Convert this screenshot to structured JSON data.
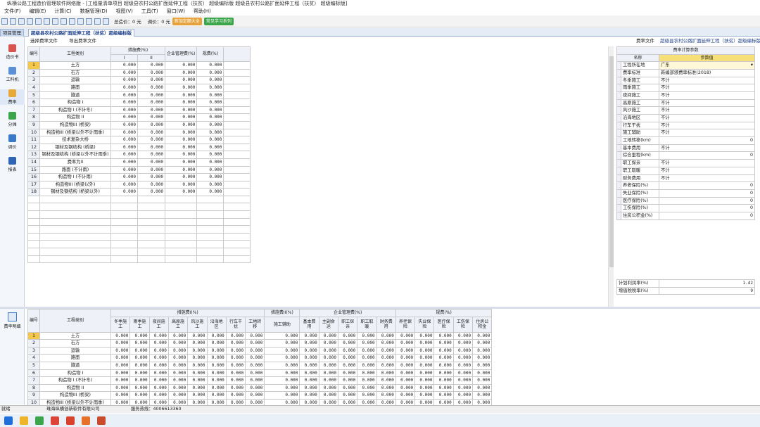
{
  "title": "纵横公路工程造价管理软件网络版 - [工程量清单项目  超级县农村公路扩面延伸工程（扶贫） 超级编标版  超级县农村公路扩面延伸工程（扶贫） 超级编标版]",
  "menu": [
    "文件(F)",
    "编辑(E)",
    "计算(C)",
    "数据管理(D)",
    "视图(V)",
    "工具(T)",
    "窗口(W)",
    "帮助(H)"
  ],
  "toolbar": {
    "total_label": "总造价：0 元",
    "unit_label": "调价：0 元",
    "btn1": "新加定额大全",
    "btn2": "常见学习系列",
    "btn1_color": "#e8a23a",
    "btn2_color": "#3aa54a"
  },
  "tabs": {
    "project": "项目管理",
    "file": "超级县农村公路扩面延伸工程（扶贫）超级编标版"
  },
  "subtabs": [
    "选择费率文件",
    "导出费率文件"
  ],
  "breadcrumb": {
    "label": "费率文件",
    "value": "超级县农村公路扩面延伸工程（扶贫）超级编标版"
  },
  "nav": [
    {
      "label": "造价书",
      "icon": "price-book-icon",
      "color": "#d9534f"
    },
    {
      "label": "工料机",
      "icon": "materials-icon",
      "color": "#5b8fd6"
    },
    {
      "label": "费率",
      "icon": "rate-icon",
      "color": "#e7a93a"
    },
    {
      "label": "分摊",
      "icon": "allocate-icon",
      "color": "#3aa54a"
    },
    {
      "label": "调价",
      "icon": "adjust-icon",
      "color": "#3a78c8"
    },
    {
      "label": "报表",
      "icon": "report-icon",
      "color": "#2e66b5"
    }
  ],
  "bottom_nav": {
    "label": "费率明细",
    "icon": "rate-detail-icon"
  },
  "main": {
    "headers": {
      "type": "工程类别",
      "group1": "措施费(%)",
      "sub1": "I",
      "sub2": "II",
      "group2": "企业管理费(%)",
      "group3": "规费(%)"
    },
    "rows": [
      {
        "no": "1",
        "name": "土方",
        "v": [
          "0.000",
          "0.000",
          "0.000",
          "0.000"
        ]
      },
      {
        "no": "2",
        "name": "石方",
        "v": [
          "0.000",
          "0.000",
          "0.000",
          "0.000"
        ]
      },
      {
        "no": "3",
        "name": "运输",
        "v": [
          "0.000",
          "0.000",
          "0.000",
          "0.000"
        ]
      },
      {
        "no": "4",
        "name": "路面",
        "v": [
          "0.000",
          "0.000",
          "0.000",
          "0.000"
        ]
      },
      {
        "no": "5",
        "name": "隧道",
        "v": [
          "0.000",
          "0.000",
          "0.000",
          "0.000"
        ]
      },
      {
        "no": "6",
        "name": "构造物 I",
        "v": [
          "0.000",
          "0.000",
          "0.000",
          "0.000"
        ]
      },
      {
        "no": "7",
        "name": "构造物 I (不计冬)",
        "v": [
          "0.000",
          "0.000",
          "0.000",
          "0.000"
        ]
      },
      {
        "no": "8",
        "name": "构造物 II",
        "v": [
          "0.000",
          "0.000",
          "0.000",
          "0.000"
        ]
      },
      {
        "no": "9",
        "name": "构造物III (桥梁)",
        "v": [
          "0.000",
          "0.000",
          "0.000",
          "0.000"
        ]
      },
      {
        "no": "10",
        "name": "构造物III (桥梁以外不计雨季)",
        "v": [
          "0.000",
          "0.000",
          "0.000",
          "0.000"
        ]
      },
      {
        "no": "11",
        "name": "技术复杂大桥",
        "v": [
          "0.000",
          "0.000",
          "0.000",
          "0.000"
        ]
      },
      {
        "no": "12",
        "name": "钢材及钢结构 (桥梁)",
        "v": [
          "0.000",
          "0.000",
          "0.000",
          "0.000"
        ]
      },
      {
        "no": "13",
        "name": "钢材及钢结构 (桥梁以外不计雨季)",
        "v": [
          "0.000",
          "0.000",
          "0.000",
          "0.000"
        ]
      },
      {
        "no": "14",
        "name": "费率为0",
        "v": [
          "0.000",
          "0.000",
          "0.000",
          "0.000"
        ]
      },
      {
        "no": "15",
        "name": "路面 (不计雨)",
        "v": [
          "0.000",
          "0.000",
          "0.000",
          "0.000"
        ]
      },
      {
        "no": "16",
        "name": "构造物 I (不计雨)",
        "v": [
          "0.000",
          "0.000",
          "0.000",
          "0.000"
        ]
      },
      {
        "no": "17",
        "name": "构造物III (桥梁以外)",
        "v": [
          "0.000",
          "0.000",
          "0.000",
          "0.000"
        ]
      },
      {
        "no": "18",
        "name": "钢材及钢结构 (桥梁以外)",
        "v": [
          "0.000",
          "0.000",
          "0.000",
          "0.000"
        ]
      }
    ]
  },
  "params": {
    "title": "费率计算参数",
    "col1": "名称",
    "col2": "参数值",
    "rows": [
      {
        "k": "工程所在地",
        "v": "广东",
        "dropdown": true
      },
      {
        "k": "费率标准",
        "v": "新编部颁费率标准(2018)"
      },
      {
        "k": "冬季施工",
        "v": "不计"
      },
      {
        "k": "雨季施工",
        "v": "不计"
      },
      {
        "k": "夜间施工",
        "v": "不计"
      },
      {
        "k": "高原施工",
        "v": "不计"
      },
      {
        "k": "风沙施工",
        "v": "不计"
      },
      {
        "k": "沿海地区",
        "v": "不计"
      },
      {
        "k": "行车干扰",
        "v": "不计"
      },
      {
        "k": "施工辅助",
        "v": "不计"
      },
      {
        "k": "工地转移(km)",
        "v": "0",
        "num": true
      },
      {
        "k": "基本费用",
        "v": "不计"
      },
      {
        "k": "综合里程(km)",
        "v": "0",
        "num": true
      },
      {
        "k": "职工探亲",
        "v": "不计"
      },
      {
        "k": "职工取暖",
        "v": "不计"
      },
      {
        "k": "财务费用",
        "v": "不计"
      },
      {
        "k": "养老保险(%)",
        "v": "0",
        "num": true
      },
      {
        "k": "失业保险(%)",
        "v": "0",
        "num": true
      },
      {
        "k": "医疗保险(%)",
        "v": "0",
        "num": true
      },
      {
        "k": "工伤保险(%)",
        "v": "0",
        "num": true
      },
      {
        "k": "住房公积金(%)",
        "v": "0",
        "num": true
      }
    ],
    "profit_label": "计划利润率(%)",
    "profit_value": "1.42",
    "tax_label": "增值税税率(%)",
    "tax_value": "9"
  },
  "bottom": {
    "type": "工程类别",
    "g1": "措施费I(%)",
    "g2": "措施费II(%)",
    "g3": "企业管理费(%)",
    "g4": "规费(%)",
    "cols1": [
      "冬季施工",
      "雨季施工",
      "夜间施工",
      "高原施工",
      "风沙施工",
      "沿海地区",
      "行车干扰",
      "工地转移"
    ],
    "cols2": [
      "施工辅助"
    ],
    "cols3": [
      "基本费用",
      "主副食运",
      "职工探亲",
      "职工取暖",
      "财务费用"
    ],
    "cols4": [
      "养老保险",
      "失业保险",
      "医疗保险",
      "工伤保险",
      "住房公积金"
    ],
    "rows": [
      {
        "no": "1",
        "name": "土方"
      },
      {
        "no": "2",
        "name": "石方"
      },
      {
        "no": "3",
        "name": "运输"
      },
      {
        "no": "4",
        "name": "路面"
      },
      {
        "no": "5",
        "name": "隧道"
      },
      {
        "no": "6",
        "name": "构造物 I"
      },
      {
        "no": "7",
        "name": "构造物 I (不计冬)"
      },
      {
        "no": "8",
        "name": "构造物 II"
      },
      {
        "no": "9",
        "name": "构造物III (桥梁)"
      },
      {
        "no": "10",
        "name": "构造物III (桥梁以外不计雨季)"
      }
    ],
    "zero": "0.000"
  },
  "status": {
    "left": "就绪",
    "company": "珠海纵横创新软件有限公司",
    "hotline": "服务热线：4006613360"
  },
  "taskbar": [
    "start-icon",
    "file-explorer-icon",
    "refresh-app-icon",
    "chrome-icon",
    "wps-icon",
    "zongheng-icon",
    "ppt-icon"
  ]
}
